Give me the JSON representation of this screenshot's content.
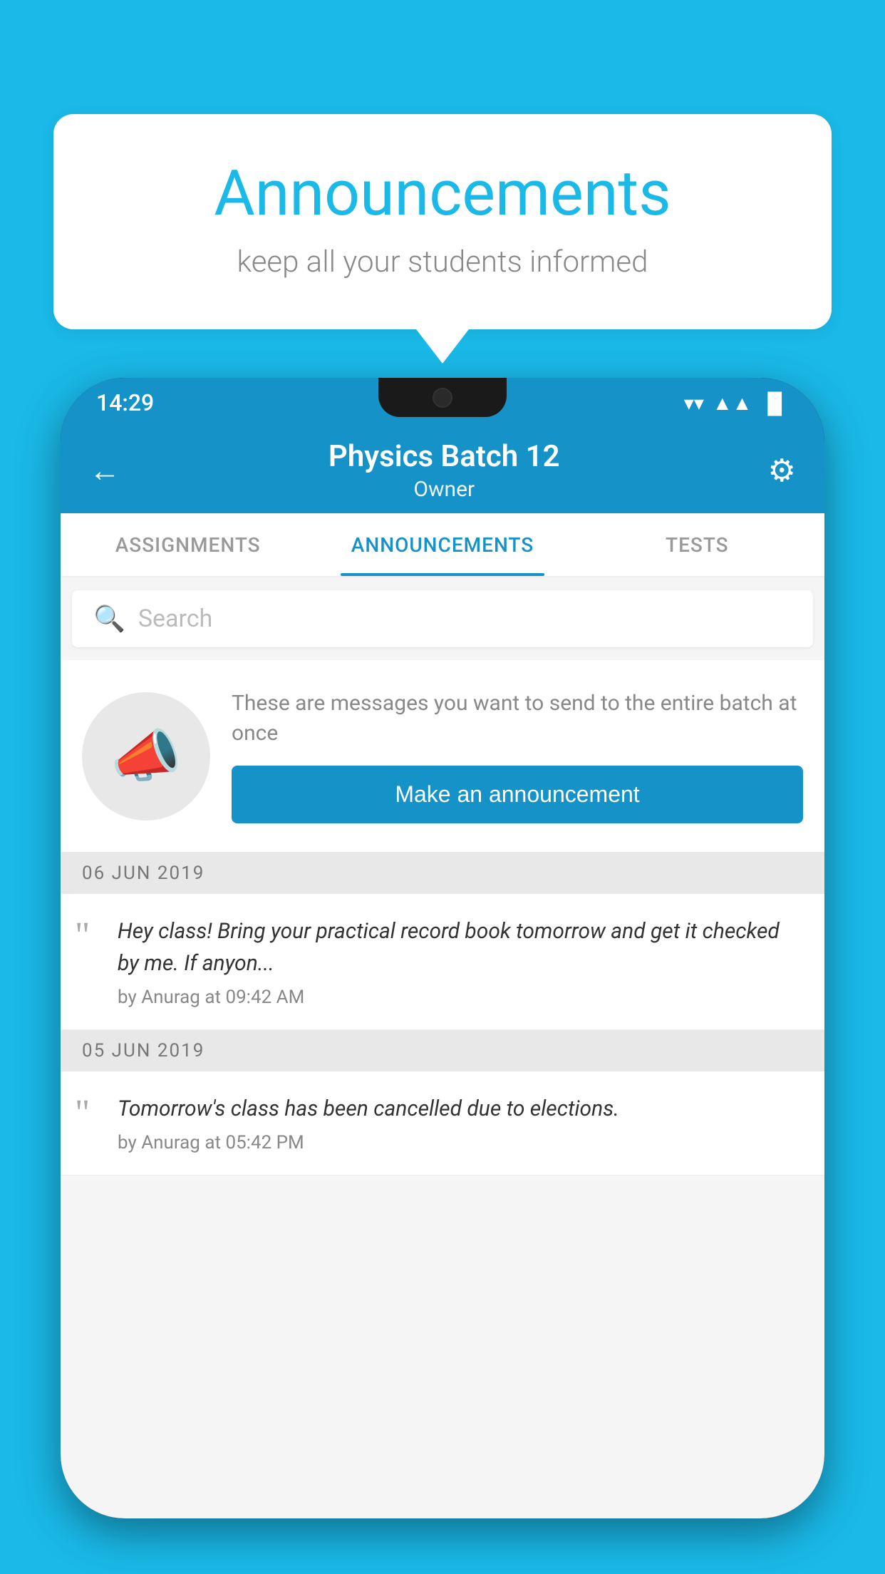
{
  "background_color": "#1ab9e8",
  "speech_bubble": {
    "title": "Announcements",
    "subtitle": "keep all your students informed"
  },
  "status_bar": {
    "time": "14:29",
    "wifi": "▼",
    "signal": "▲",
    "battery": "▐"
  },
  "app_header": {
    "back_label": "←",
    "title": "Physics Batch 12",
    "subtitle": "Owner",
    "settings_label": "⚙"
  },
  "tabs": [
    {
      "label": "ASSIGNMENTS",
      "active": false
    },
    {
      "label": "ANNOUNCEMENTS",
      "active": true
    },
    {
      "label": "TESTS",
      "active": false
    }
  ],
  "search": {
    "placeholder": "Search"
  },
  "announcement_prompt": {
    "description_text": "These are messages you want to send to the entire batch at once",
    "button_label": "Make an announcement"
  },
  "announcements": [
    {
      "date": "06  JUN  2019",
      "items": [
        {
          "text": "Hey class! Bring your practical record book tomorrow and get it checked by me. If anyon...",
          "meta": "by Anurag at 09:42 AM"
        }
      ]
    },
    {
      "date": "05  JUN  2019",
      "items": [
        {
          "text": "Tomorrow's class has been cancelled due to elections.",
          "meta": "by Anurag at 05:42 PM"
        }
      ]
    }
  ]
}
